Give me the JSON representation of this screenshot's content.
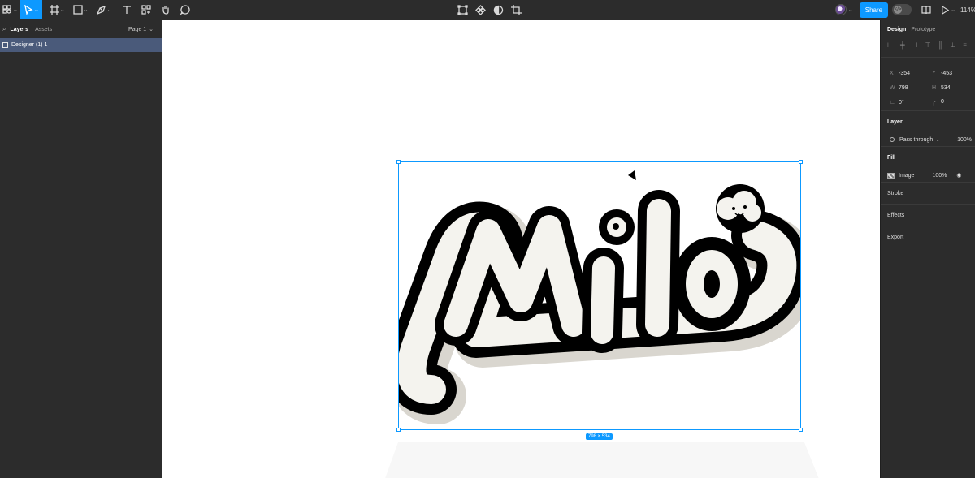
{
  "toolbar": {
    "tools": [
      {
        "name": "main-menu",
        "icon": "figma-menu-icon"
      },
      {
        "name": "move",
        "icon": "pointer-icon",
        "active": true
      },
      {
        "name": "frame",
        "icon": "frame-icon"
      },
      {
        "name": "shape",
        "icon": "rectangle-icon"
      },
      {
        "name": "pen",
        "icon": "pen-icon"
      },
      {
        "name": "text",
        "icon": "text-icon"
      },
      {
        "name": "resources",
        "icon": "components-icon"
      },
      {
        "name": "hand",
        "icon": "hand-icon"
      },
      {
        "name": "comment",
        "icon": "comment-icon"
      }
    ],
    "center_tools": [
      "edit-object-icon",
      "component-icon",
      "mask-icon",
      "crop-icon"
    ],
    "share_label": "Share",
    "zoom": "114%"
  },
  "left_panel": {
    "tab_layers": "Layers",
    "tab_assets": "Assets",
    "page_label": "Page 1",
    "layers": [
      {
        "name": "Designer (1) 1",
        "selected": true
      }
    ]
  },
  "canvas": {
    "selection_size": "798 × 534",
    "logo_text": "Milo",
    "accent": "#0d99ff"
  },
  "right_panel": {
    "tab_design": "Design",
    "tab_prototype": "Prototype",
    "x_label": "X",
    "x": "-354",
    "y_label": "Y",
    "y": "-453",
    "w_label": "W",
    "w": "798",
    "h_label": "H",
    "h": "534",
    "rotation": "0°",
    "radius": "0",
    "layer_title": "Layer",
    "blend_mode": "Pass through",
    "layer_opacity": "100%",
    "fill_title": "Fill",
    "fill_type": "Image",
    "fill_opacity": "100%",
    "stroke_title": "Stroke",
    "effects_title": "Effects",
    "export_title": "Export"
  }
}
